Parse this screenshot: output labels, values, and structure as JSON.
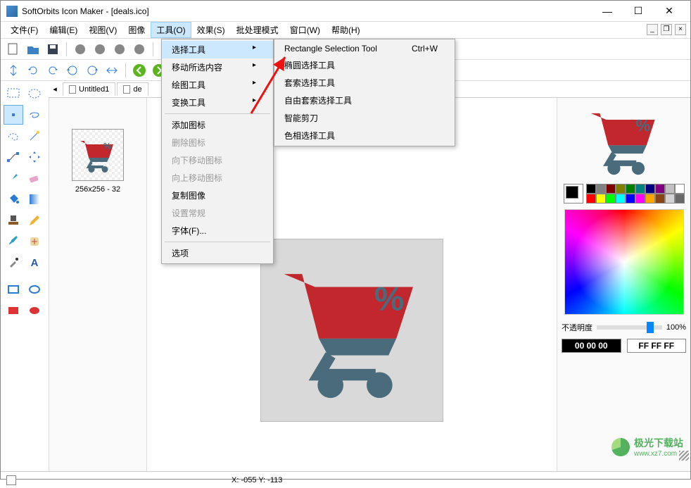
{
  "window": {
    "title": "SoftOrbits Icon Maker - [deals.ico]"
  },
  "menubar": {
    "file": "文件(F)",
    "edit": "编辑(E)",
    "view": "视图(V)",
    "image": "图像",
    "tools": "工具(O)",
    "effects": "效果(S)",
    "batch": "批处理模式",
    "window": "窗口(W)",
    "help": "帮助(H)"
  },
  "tools_menu": {
    "select_tools": "选择工具",
    "move_selection": "移动所选内容",
    "draw_tools": "绘图工具",
    "transform_tools": "变换工具",
    "add_icon": "添加图标",
    "delete_icon": "删除图标",
    "move_icon_down": "向下移动图标",
    "move_icon_up": "向上移动图标",
    "copy_image": "复制图像",
    "settings": "设置常规",
    "font": "字体(F)...",
    "options": "选项"
  },
  "submenu": {
    "rectangle_selection": "Rectangle Selection Tool",
    "rectangle_shortcut": "Ctrl+W",
    "ellipse_selection": "椭圆选择工具",
    "lasso_selection": "套索选择工具",
    "free_lasso": "自由套索选择工具",
    "smart_scissors": "智能剪刀",
    "hue_selection": "色相选择工具"
  },
  "tabs": {
    "tab1": "Untitled1",
    "tab2": "de"
  },
  "thumbnail": {
    "label": "256x256 - 32"
  },
  "right": {
    "opacity_label": "不透明度",
    "opacity_value": "100%",
    "hex_black": "00 00 00",
    "hex_white": "FF FF FF"
  },
  "palette_colors": [
    [
      "#000000",
      "#808080",
      "#800000",
      "#808000",
      "#008000",
      "#008080",
      "#000080",
      "#800080",
      "#c0c0c0",
      "#ffffff"
    ],
    [
      "#ff0000",
      "#ffff00",
      "#00ff00",
      "#00ffff",
      "#0000ff",
      "#ff00ff",
      "#ffa500",
      "#8b4513",
      "#d3d3d3",
      "#696969"
    ]
  ],
  "status": {
    "coord": "X: -055 Y: -113"
  },
  "watermark": {
    "text": "极光下载站",
    "url": "www.xz7.com"
  }
}
